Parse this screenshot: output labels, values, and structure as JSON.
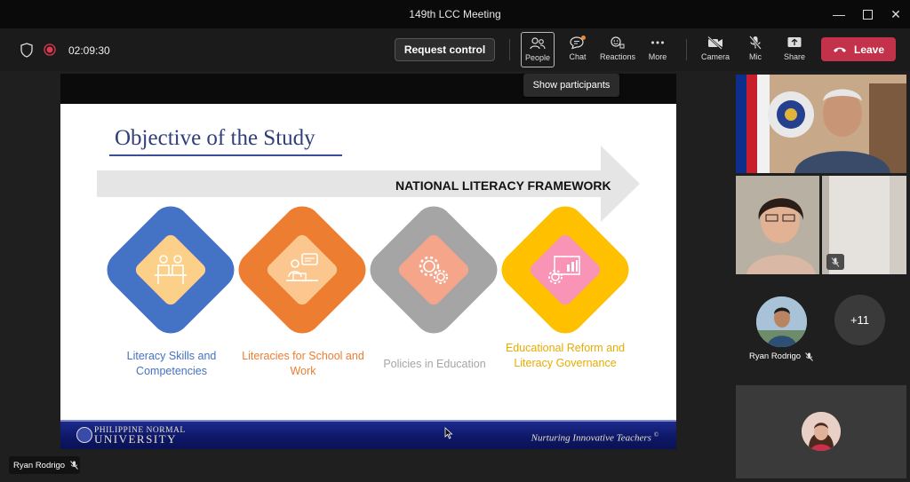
{
  "window": {
    "title": "149th LCC Meeting",
    "controls": [
      "minimize-icon",
      "maximize-icon",
      "close-icon"
    ]
  },
  "toolbar": {
    "timer": "02:09:30",
    "request_control": "Request control",
    "buttons": [
      {
        "label": "People",
        "icon": "people-icon"
      },
      {
        "label": "Chat",
        "icon": "chat-icon"
      },
      {
        "label": "Reactions",
        "icon": "reactions-icon"
      },
      {
        "label": "More",
        "icon": "more-icon"
      },
      {
        "label": "Camera",
        "icon": "camera-off-icon"
      },
      {
        "label": "Mic",
        "icon": "mic-off-icon"
      },
      {
        "label": "Share",
        "icon": "share-icon"
      }
    ],
    "leave": "Leave",
    "leave_color": "#c4314b"
  },
  "tooltip": "Show participants",
  "slide": {
    "title": "Objective of the Study",
    "arrow_label": "NATIONAL LITERACY FRAMEWORK",
    "items": [
      {
        "caption": "Literacy Skills and Competencies",
        "color": "#4472c4",
        "inner": "#fdd08a",
        "text_color": "#4472c4"
      },
      {
        "caption": "Literacies for School and Work",
        "color": "#ed7d31",
        "inner": "#fbc78e",
        "text_color": "#ed7d31"
      },
      {
        "caption": "Policies in Education",
        "color": "#a5a5a5",
        "inner": "#f5a58a",
        "text_color": "#a5a5a5"
      },
      {
        "caption": "Educational Reform and Literacy Governance",
        "color": "#ffc000",
        "inner": "#f994b6",
        "text_color": "#e6ac00"
      }
    ],
    "footer": {
      "university_line1": "Philippine Normal",
      "university_line2": "University",
      "motto": "Nurturing Innovative Teachers",
      "trademark": "©"
    }
  },
  "presenter_label": "Ryan Rodrigo",
  "participants": {
    "overflow_count": "+11",
    "named_tile": "Ryan Rodrigo"
  }
}
